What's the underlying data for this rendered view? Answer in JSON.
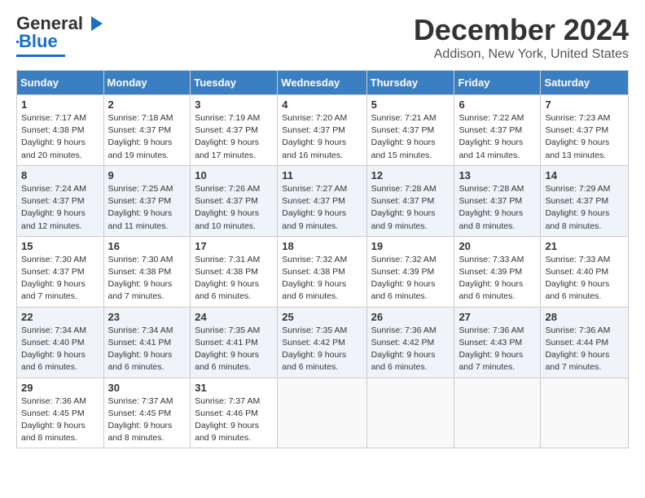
{
  "header": {
    "logo_general": "General",
    "logo_blue": "Blue",
    "title": "December 2024",
    "location": "Addison, New York, United States"
  },
  "days_of_week": [
    "Sunday",
    "Monday",
    "Tuesday",
    "Wednesday",
    "Thursday",
    "Friday",
    "Saturday"
  ],
  "weeks": [
    [
      {
        "day": 1,
        "sunrise": "7:17 AM",
        "sunset": "4:38 PM",
        "daylight": "9 hours and 20 minutes."
      },
      {
        "day": 2,
        "sunrise": "7:18 AM",
        "sunset": "4:37 PM",
        "daylight": "9 hours and 19 minutes."
      },
      {
        "day": 3,
        "sunrise": "7:19 AM",
        "sunset": "4:37 PM",
        "daylight": "9 hours and 17 minutes."
      },
      {
        "day": 4,
        "sunrise": "7:20 AM",
        "sunset": "4:37 PM",
        "daylight": "9 hours and 16 minutes."
      },
      {
        "day": 5,
        "sunrise": "7:21 AM",
        "sunset": "4:37 PM",
        "daylight": "9 hours and 15 minutes."
      },
      {
        "day": 6,
        "sunrise": "7:22 AM",
        "sunset": "4:37 PM",
        "daylight": "9 hours and 14 minutes."
      },
      {
        "day": 7,
        "sunrise": "7:23 AM",
        "sunset": "4:37 PM",
        "daylight": "9 hours and 13 minutes."
      }
    ],
    [
      {
        "day": 8,
        "sunrise": "7:24 AM",
        "sunset": "4:37 PM",
        "daylight": "9 hours and 12 minutes."
      },
      {
        "day": 9,
        "sunrise": "7:25 AM",
        "sunset": "4:37 PM",
        "daylight": "9 hours and 11 minutes."
      },
      {
        "day": 10,
        "sunrise": "7:26 AM",
        "sunset": "4:37 PM",
        "daylight": "9 hours and 10 minutes."
      },
      {
        "day": 11,
        "sunrise": "7:27 AM",
        "sunset": "4:37 PM",
        "daylight": "9 hours and 9 minutes."
      },
      {
        "day": 12,
        "sunrise": "7:28 AM",
        "sunset": "4:37 PM",
        "daylight": "9 hours and 9 minutes."
      },
      {
        "day": 13,
        "sunrise": "7:28 AM",
        "sunset": "4:37 PM",
        "daylight": "9 hours and 8 minutes."
      },
      {
        "day": 14,
        "sunrise": "7:29 AM",
        "sunset": "4:37 PM",
        "daylight": "9 hours and 8 minutes."
      }
    ],
    [
      {
        "day": 15,
        "sunrise": "7:30 AM",
        "sunset": "4:37 PM",
        "daylight": "9 hours and 7 minutes."
      },
      {
        "day": 16,
        "sunrise": "7:30 AM",
        "sunset": "4:38 PM",
        "daylight": "9 hours and 7 minutes."
      },
      {
        "day": 17,
        "sunrise": "7:31 AM",
        "sunset": "4:38 PM",
        "daylight": "9 hours and 6 minutes."
      },
      {
        "day": 18,
        "sunrise": "7:32 AM",
        "sunset": "4:38 PM",
        "daylight": "9 hours and 6 minutes."
      },
      {
        "day": 19,
        "sunrise": "7:32 AM",
        "sunset": "4:39 PM",
        "daylight": "9 hours and 6 minutes."
      },
      {
        "day": 20,
        "sunrise": "7:33 AM",
        "sunset": "4:39 PM",
        "daylight": "9 hours and 6 minutes."
      },
      {
        "day": 21,
        "sunrise": "7:33 AM",
        "sunset": "4:40 PM",
        "daylight": "9 hours and 6 minutes."
      }
    ],
    [
      {
        "day": 22,
        "sunrise": "7:34 AM",
        "sunset": "4:40 PM",
        "daylight": "9 hours and 6 minutes."
      },
      {
        "day": 23,
        "sunrise": "7:34 AM",
        "sunset": "4:41 PM",
        "daylight": "9 hours and 6 minutes."
      },
      {
        "day": 24,
        "sunrise": "7:35 AM",
        "sunset": "4:41 PM",
        "daylight": "9 hours and 6 minutes."
      },
      {
        "day": 25,
        "sunrise": "7:35 AM",
        "sunset": "4:42 PM",
        "daylight": "9 hours and 6 minutes."
      },
      {
        "day": 26,
        "sunrise": "7:36 AM",
        "sunset": "4:42 PM",
        "daylight": "9 hours and 6 minutes."
      },
      {
        "day": 27,
        "sunrise": "7:36 AM",
        "sunset": "4:43 PM",
        "daylight": "9 hours and 7 minutes."
      },
      {
        "day": 28,
        "sunrise": "7:36 AM",
        "sunset": "4:44 PM",
        "daylight": "9 hours and 7 minutes."
      }
    ],
    [
      {
        "day": 29,
        "sunrise": "7:36 AM",
        "sunset": "4:45 PM",
        "daylight": "9 hours and 8 minutes."
      },
      {
        "day": 30,
        "sunrise": "7:37 AM",
        "sunset": "4:45 PM",
        "daylight": "9 hours and 8 minutes."
      },
      {
        "day": 31,
        "sunrise": "7:37 AM",
        "sunset": "4:46 PM",
        "daylight": "9 hours and 9 minutes."
      },
      null,
      null,
      null,
      null
    ]
  ]
}
